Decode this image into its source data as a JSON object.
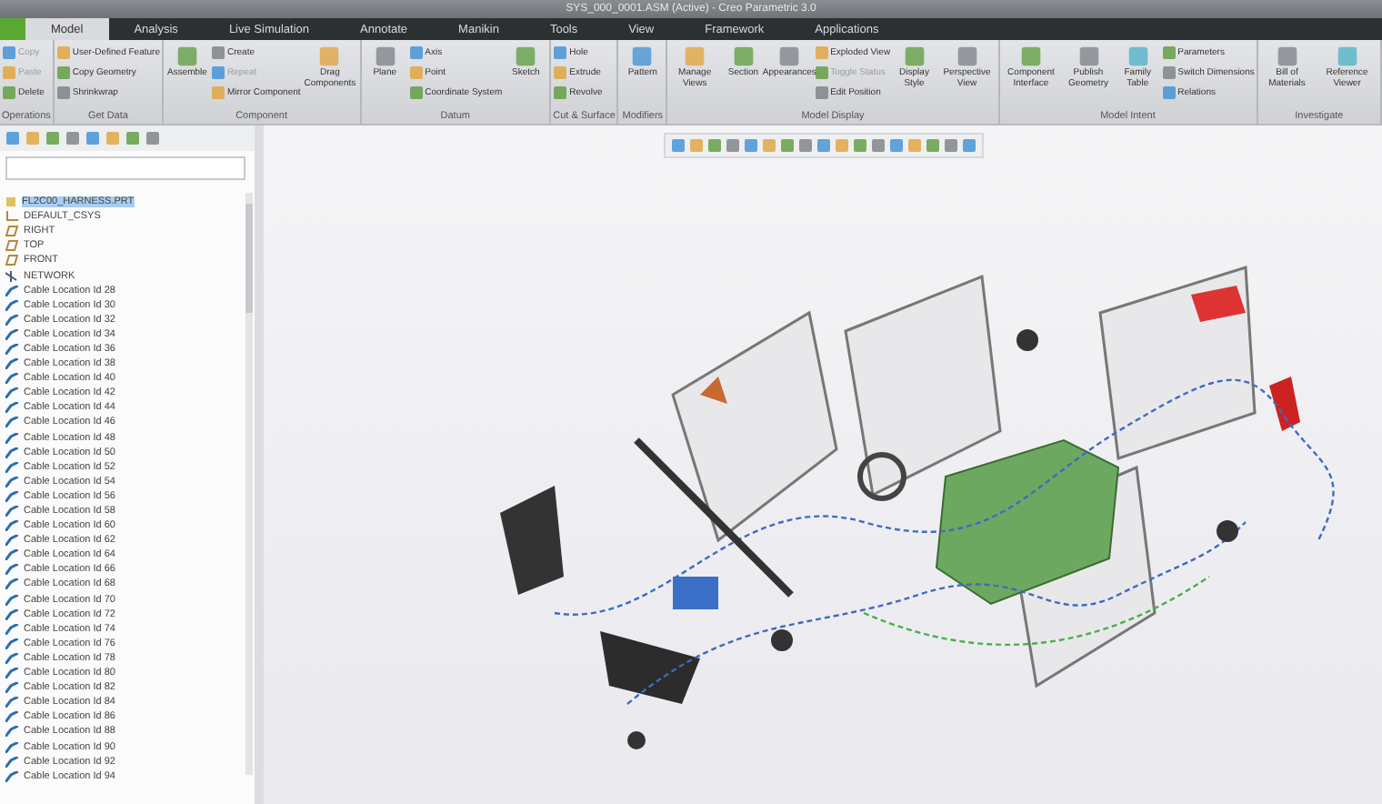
{
  "window": {
    "title": "SYS_000_0001.ASM (Active) - Creo Parametric 3.0"
  },
  "tabs": [
    {
      "label": "Model",
      "selected": true
    },
    {
      "label": "Analysis",
      "selected": false
    },
    {
      "label": "Live Simulation",
      "selected": false
    },
    {
      "label": "Annotate",
      "selected": false
    },
    {
      "label": "Manikin",
      "selected": false
    },
    {
      "label": "Tools",
      "selected": false
    },
    {
      "label": "View",
      "selected": false
    },
    {
      "label": "Framework",
      "selected": false
    },
    {
      "label": "Applications",
      "selected": false
    }
  ],
  "ribbon": [
    {
      "label": "Operations",
      "buttons": [
        {
          "label": "Copy",
          "kind": "small",
          "disabled": true
        },
        {
          "label": "Paste",
          "kind": "small",
          "disabled": true
        },
        {
          "label": "Delete",
          "kind": "small",
          "disabled": false
        }
      ]
    },
    {
      "label": "Get Data",
      "buttons": [
        {
          "label": "User-Defined Feature",
          "kind": "small",
          "disabled": false
        },
        {
          "label": "Copy Geometry",
          "kind": "small",
          "disabled": false
        },
        {
          "label": "Shrinkwrap",
          "kind": "small",
          "disabled": false
        }
      ]
    },
    {
      "label": "Component",
      "buttons": [
        {
          "label": "Assemble",
          "kind": "large",
          "disabled": false
        },
        {
          "label": "Create",
          "kind": "small",
          "disabled": false
        },
        {
          "label": "Repeat",
          "kind": "small",
          "disabled": true
        },
        {
          "label": "Mirror Component",
          "kind": "small",
          "disabled": false
        },
        {
          "label": "Drag Components",
          "kind": "large",
          "disabled": false
        }
      ]
    },
    {
      "label": "Datum",
      "buttons": [
        {
          "label": "Plane",
          "kind": "large",
          "disabled": false
        },
        {
          "label": "Axis",
          "kind": "small",
          "disabled": false
        },
        {
          "label": "Point",
          "kind": "small",
          "disabled": false
        },
        {
          "label": "Coordinate System",
          "kind": "small",
          "disabled": false
        },
        {
          "label": "Sketch",
          "kind": "large",
          "disabled": false
        }
      ]
    },
    {
      "label": "Cut & Surface",
      "buttons": [
        {
          "label": "Hole",
          "kind": "small",
          "disabled": false
        },
        {
          "label": "Extrude",
          "kind": "small",
          "disabled": false
        },
        {
          "label": "Revolve",
          "kind": "small",
          "disabled": false
        }
      ]
    },
    {
      "label": "Modifiers",
      "buttons": [
        {
          "label": "Pattern",
          "kind": "large",
          "disabled": false
        }
      ]
    },
    {
      "label": "Model Display",
      "buttons": [
        {
          "label": "Manage Views",
          "kind": "large",
          "disabled": false
        },
        {
          "label": "Section",
          "kind": "large",
          "disabled": false
        },
        {
          "label": "Appearances",
          "kind": "large",
          "disabled": false
        },
        {
          "label": "Exploded View",
          "kind": "small",
          "disabled": false
        },
        {
          "label": "Toggle Status",
          "kind": "small",
          "disabled": true
        },
        {
          "label": "Edit Position",
          "kind": "small",
          "disabled": false
        },
        {
          "label": "Display Style",
          "kind": "large",
          "disabled": false
        },
        {
          "label": "Perspective View",
          "kind": "large",
          "disabled": false
        }
      ]
    },
    {
      "label": "Model Intent",
      "buttons": [
        {
          "label": "Component Interface",
          "kind": "large",
          "disabled": false
        },
        {
          "label": "Publish Geometry",
          "kind": "large",
          "disabled": false
        },
        {
          "label": "Family Table",
          "kind": "large",
          "disabled": false
        },
        {
          "label": "Parameters",
          "kind": "small",
          "disabled": false
        },
        {
          "label": "Switch Dimensions",
          "kind": "small",
          "disabled": false
        },
        {
          "label": "Relations",
          "kind": "small",
          "disabled": false
        }
      ]
    },
    {
      "label": "Investigate",
      "buttons": [
        {
          "label": "Bill of Materials",
          "kind": "large",
          "disabled": false
        },
        {
          "label": "Reference Viewer",
          "kind": "large",
          "disabled": false
        }
      ]
    }
  ],
  "tree": {
    "items": [
      {
        "label": "FL2C00_HARNESS.PRT",
        "kind": "root",
        "selected": true
      },
      {
        "label": "DEFAULT_CSYS",
        "kind": "csys",
        "selected": false
      },
      {
        "label": "RIGHT",
        "kind": "plane",
        "selected": false
      },
      {
        "label": "TOP",
        "kind": "plane",
        "selected": false
      },
      {
        "label": "FRONT",
        "kind": "plane",
        "selected": false
      },
      {
        "label": "NETWORK",
        "kind": "network",
        "selected": false
      },
      {
        "label": "Cable Location Id 28",
        "kind": "cable",
        "selected": false
      },
      {
        "label": "Cable Location Id 30",
        "kind": "cable",
        "selected": false
      },
      {
        "label": "Cable Location Id 32",
        "kind": "cable",
        "selected": false
      },
      {
        "label": "Cable Location Id 34",
        "kind": "cable",
        "selected": false
      },
      {
        "label": "Cable Location Id 36",
        "kind": "cable",
        "selected": false
      },
      {
        "label": "Cable Location Id 38",
        "kind": "cable",
        "selected": false
      },
      {
        "label": "Cable Location Id 40",
        "kind": "cable",
        "selected": false
      },
      {
        "label": "Cable Location Id 42",
        "kind": "cable",
        "selected": false
      },
      {
        "label": "Cable Location Id 44",
        "kind": "cable",
        "selected": false
      },
      {
        "label": "Cable Location Id 46",
        "kind": "cable",
        "selected": false
      },
      {
        "label": "Cable Location Id 48",
        "kind": "cable",
        "selected": false
      },
      {
        "label": "Cable Location Id 50",
        "kind": "cable",
        "selected": false
      },
      {
        "label": "Cable Location Id 52",
        "kind": "cable",
        "selected": false
      },
      {
        "label": "Cable Location Id 54",
        "kind": "cable",
        "selected": false
      },
      {
        "label": "Cable Location Id 56",
        "kind": "cable",
        "selected": false
      },
      {
        "label": "Cable Location Id 58",
        "kind": "cable",
        "selected": false
      },
      {
        "label": "Cable Location Id 60",
        "kind": "cable",
        "selected": false
      },
      {
        "label": "Cable Location Id 62",
        "kind": "cable",
        "selected": false
      },
      {
        "label": "Cable Location Id 64",
        "kind": "cable",
        "selected": false
      },
      {
        "label": "Cable Location Id 66",
        "kind": "cable",
        "selected": false
      },
      {
        "label": "Cable Location Id 68",
        "kind": "cable",
        "selected": false
      },
      {
        "label": "Cable Location Id 70",
        "kind": "cable",
        "selected": false
      },
      {
        "label": "Cable Location Id 72",
        "kind": "cable",
        "selected": false
      },
      {
        "label": "Cable Location Id 74",
        "kind": "cable",
        "selected": false
      },
      {
        "label": "Cable Location Id 76",
        "kind": "cable",
        "selected": false
      },
      {
        "label": "Cable Location Id 78",
        "kind": "cable",
        "selected": false
      },
      {
        "label": "Cable Location Id 80",
        "kind": "cable",
        "selected": false
      },
      {
        "label": "Cable Location Id 82",
        "kind": "cable",
        "selected": false
      },
      {
        "label": "Cable Location Id 84",
        "kind": "cable",
        "selected": false
      },
      {
        "label": "Cable Location Id 86",
        "kind": "cable",
        "selected": false
      },
      {
        "label": "Cable Location Id 88",
        "kind": "cable",
        "selected": false
      },
      {
        "label": "Cable Location Id 90",
        "kind": "cable",
        "selected": false
      },
      {
        "label": "Cable Location Id 92",
        "kind": "cable",
        "selected": false
      },
      {
        "label": "Cable Location Id 94",
        "kind": "cable",
        "selected": false
      }
    ]
  }
}
